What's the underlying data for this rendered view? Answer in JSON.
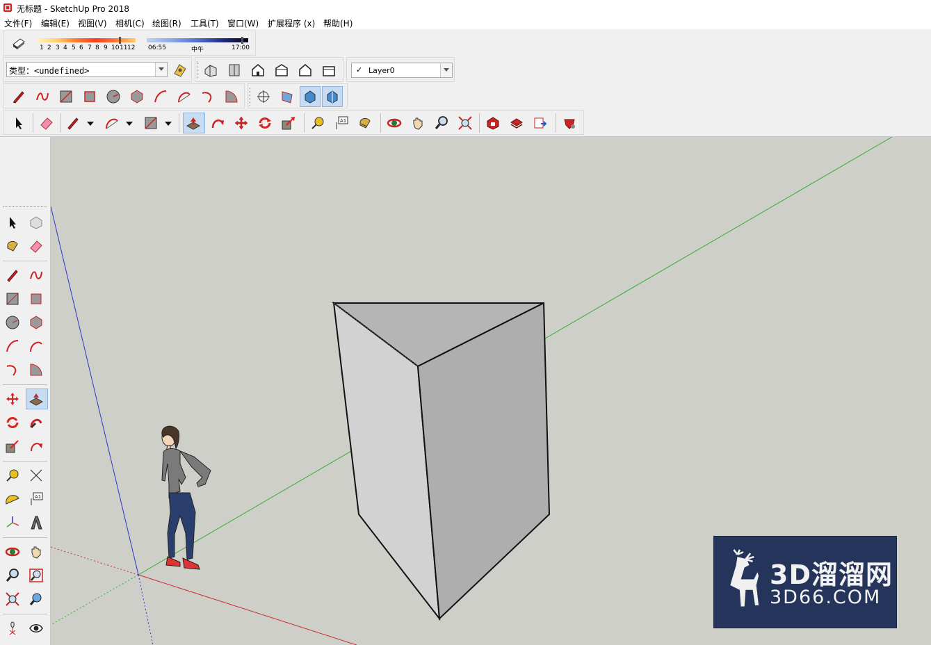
{
  "window": {
    "title": "无标题 - SketchUp Pro 2018"
  },
  "menu": [
    "文件(F)",
    "编辑(E)",
    "视图(V)",
    "相机(C)",
    "绘图(R)",
    "工具(T)",
    "窗口(W)",
    "扩展程序 (x)",
    "帮助(H)"
  ],
  "shadows": {
    "months": [
      "1",
      "2",
      "3",
      "4",
      "5",
      "6",
      "7",
      "8",
      "9",
      "10",
      "11",
      "12"
    ],
    "time_start": "06:55",
    "time_mid": "中午",
    "time_end": "17:00",
    "month_position": 0.83,
    "time_position": 0.93
  },
  "styles": {
    "type_label": "类型：<undefined>"
  },
  "layers": {
    "current": "Layer0",
    "check": "✓"
  },
  "watermark": {
    "line1": "3D溜溜网",
    "line2": "3D66.COM",
    "bg": "#24345a"
  },
  "colors": {
    "axis_red": "#cc3333",
    "axis_green": "#33aa33",
    "axis_blue": "#3344cc",
    "viewport_bg": "#cfcfc9"
  }
}
